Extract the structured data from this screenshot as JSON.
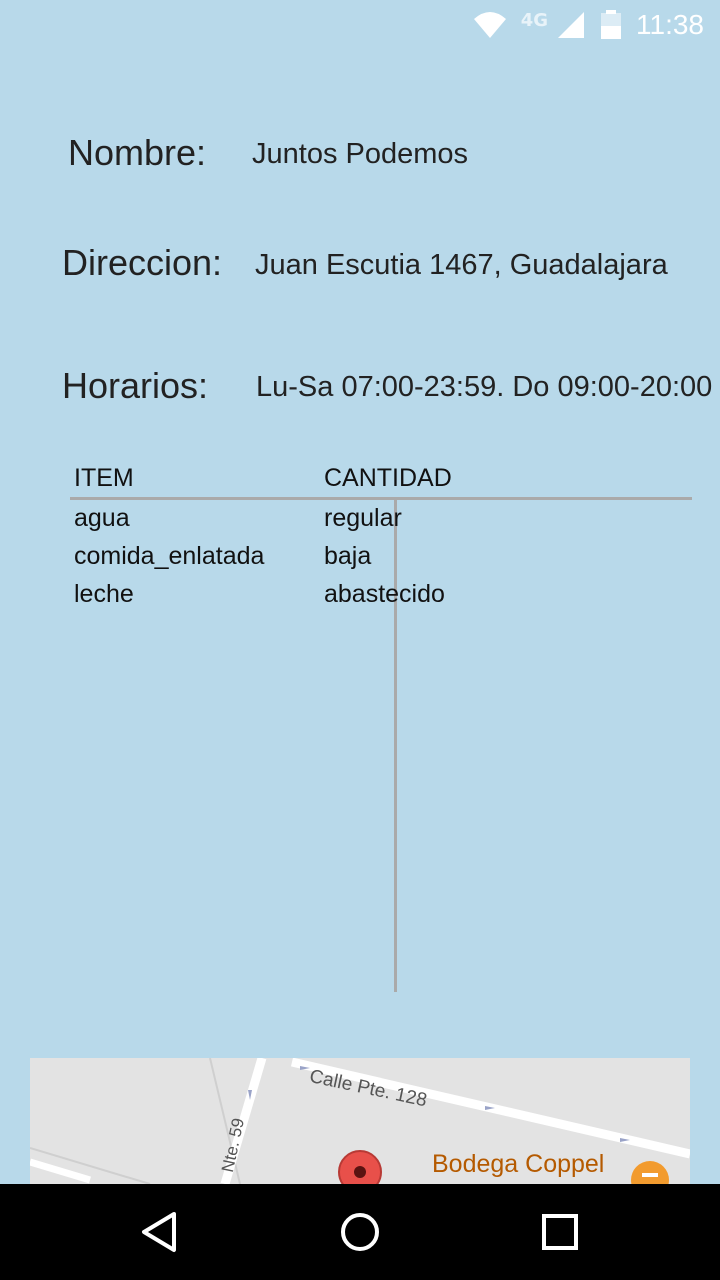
{
  "status_bar": {
    "time": "11:38",
    "network": "4G",
    "icons": [
      "wifi-icon",
      "signal-icon",
      "battery-icon"
    ]
  },
  "details": {
    "name_label": "Nombre:",
    "name_value": "Juntos Podemos",
    "address_label": "Direccion:",
    "address_value": "Juan Escutia 1467, Guadalajara",
    "hours_label": "Horarios:",
    "hours_value": "Lu-Sa 07:00-23:59. Do 09:00-20:00"
  },
  "table": {
    "headers": [
      "ITEM",
      "CANTIDAD"
    ],
    "rows": [
      {
        "item": "agua",
        "cantidad": "regular"
      },
      {
        "item": "comida_enlatada",
        "cantidad": "baja"
      },
      {
        "item": "leche",
        "cantidad": "abastecido"
      }
    ]
  },
  "map": {
    "street_1": "Calle Pte. 128",
    "street_2": "Nte. 59",
    "poi": "Bodega Coppel",
    "pin_color": "#e8504a",
    "poi_color": "#b55a00"
  },
  "nav_bar": {
    "icons": [
      "back-icon",
      "home-icon",
      "recents-icon"
    ]
  }
}
